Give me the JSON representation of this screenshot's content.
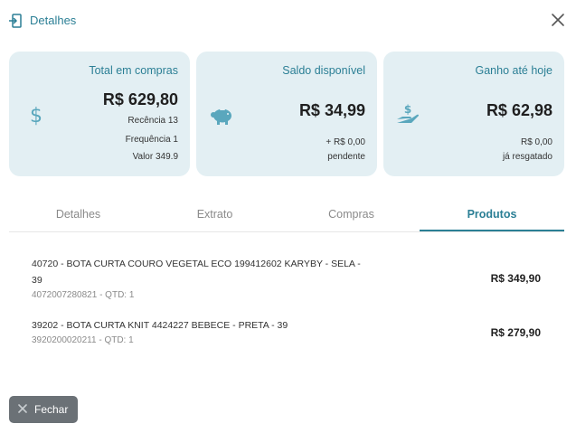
{
  "header": {
    "title": "Detalhes",
    "icon": "document-enter-icon",
    "close_icon": "close-icon"
  },
  "cards": [
    {
      "title": "Total em compras",
      "value": "R$ 629,80",
      "icon": "dollar-icon",
      "lines": [
        "Recência 13",
        "Frequência 1",
        "Valor 349.9"
      ]
    },
    {
      "title": "Saldo disponível",
      "value": "R$ 34,99",
      "icon": "piggy-bank-icon",
      "lines": [
        "+ R$ 0,00",
        "pendente"
      ]
    },
    {
      "title": "Ganho até hoje",
      "value": "R$ 62,98",
      "icon": "hand-money-icon",
      "lines": [
        "R$ 0,00",
        "já resgatado"
      ]
    }
  ],
  "tabs": [
    {
      "label": "Detalhes",
      "active": false
    },
    {
      "label": "Extrato",
      "active": false
    },
    {
      "label": "Compras",
      "active": false
    },
    {
      "label": "Produtos",
      "active": true
    }
  ],
  "products": [
    {
      "name": "40720 - BOTA CURTA COURO VEGETAL ECO 199412602 KARYBY - SELA - 39",
      "meta": "4072007280821 - QTD: 1",
      "price": "R$ 349,90"
    },
    {
      "name": "39202 - BOTA CURTA KNIT 4424227 BEBECE - PRETA - 39",
      "meta": "3920200020211 - QTD: 1",
      "price": "R$ 279,90"
    }
  ],
  "footer": {
    "close_label": "Fechar"
  },
  "colors": {
    "accent": "#2b7f95",
    "card_bg": "#e3eff3",
    "button_bg": "#6b7176",
    "icon": "#5aa7bd"
  }
}
